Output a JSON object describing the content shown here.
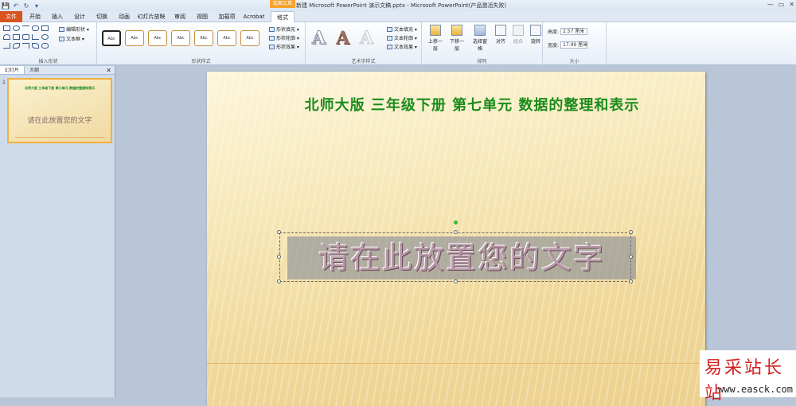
{
  "window": {
    "title": "新建 Microsoft PowerPoint 演示文稿.pptx - Microsoft PowerPoint(产品激活失败)",
    "contextual_tab": "绘图工具",
    "controls": [
      "—",
      "▭",
      "✕"
    ]
  },
  "qat": {
    "icons": [
      "save-icon",
      "undo-icon",
      "redo-icon",
      "customize-icon"
    ],
    "glyphs": [
      "💾",
      "↶",
      "↻",
      "▾"
    ]
  },
  "tabs": [
    {
      "label": "文件"
    },
    {
      "label": "开始"
    },
    {
      "label": "插入"
    },
    {
      "label": "设计"
    },
    {
      "label": "切换"
    },
    {
      "label": "动画"
    },
    {
      "label": "幻灯片放映"
    },
    {
      "label": "审阅"
    },
    {
      "label": "视图"
    },
    {
      "label": "加载项"
    },
    {
      "label": "Acrobat"
    },
    {
      "label": "格式"
    }
  ],
  "ribbon": {
    "insert_shapes": {
      "label": "插入形状",
      "edit_shape": "编辑形状 ▾",
      "text_box": "文本框 ▾"
    },
    "shape_styles": {
      "label": "形状样式",
      "swatch": "Abc",
      "fill": "形状填充 ▾",
      "outline": "形状轮廓 ▾",
      "effects": "形状效果 ▾"
    },
    "wordart_styles": {
      "label": "艺术字样式",
      "glyph": "A",
      "text_fill": "文本填充 ▾",
      "text_outline": "文本轮廓 ▾",
      "text_effects": "文本效果 ▾"
    },
    "arrange": {
      "label": "排列",
      "bring_forward": "上移一层",
      "send_backward": "下移一层",
      "selection_pane": "选择窗格",
      "align": "对齐",
      "group": "组合",
      "rotate": "旋转"
    },
    "size": {
      "label": "大小",
      "height_label": "高度:",
      "height_value": "2.57 厘米",
      "width_label": "宽度:",
      "width_value": "17.99 厘米"
    }
  },
  "left_pane": {
    "tab_slides": "幻灯片",
    "tab_outline": "大纲",
    "close": "✕",
    "slide_number": "1"
  },
  "slide": {
    "title": "北师大版  三年级下册  第七单元  数据的整理和表示",
    "placeholder_text": "请在此放置您的文字"
  },
  "watermark": {
    "cn": "易采站长站",
    "url": "www.easck.com"
  }
}
